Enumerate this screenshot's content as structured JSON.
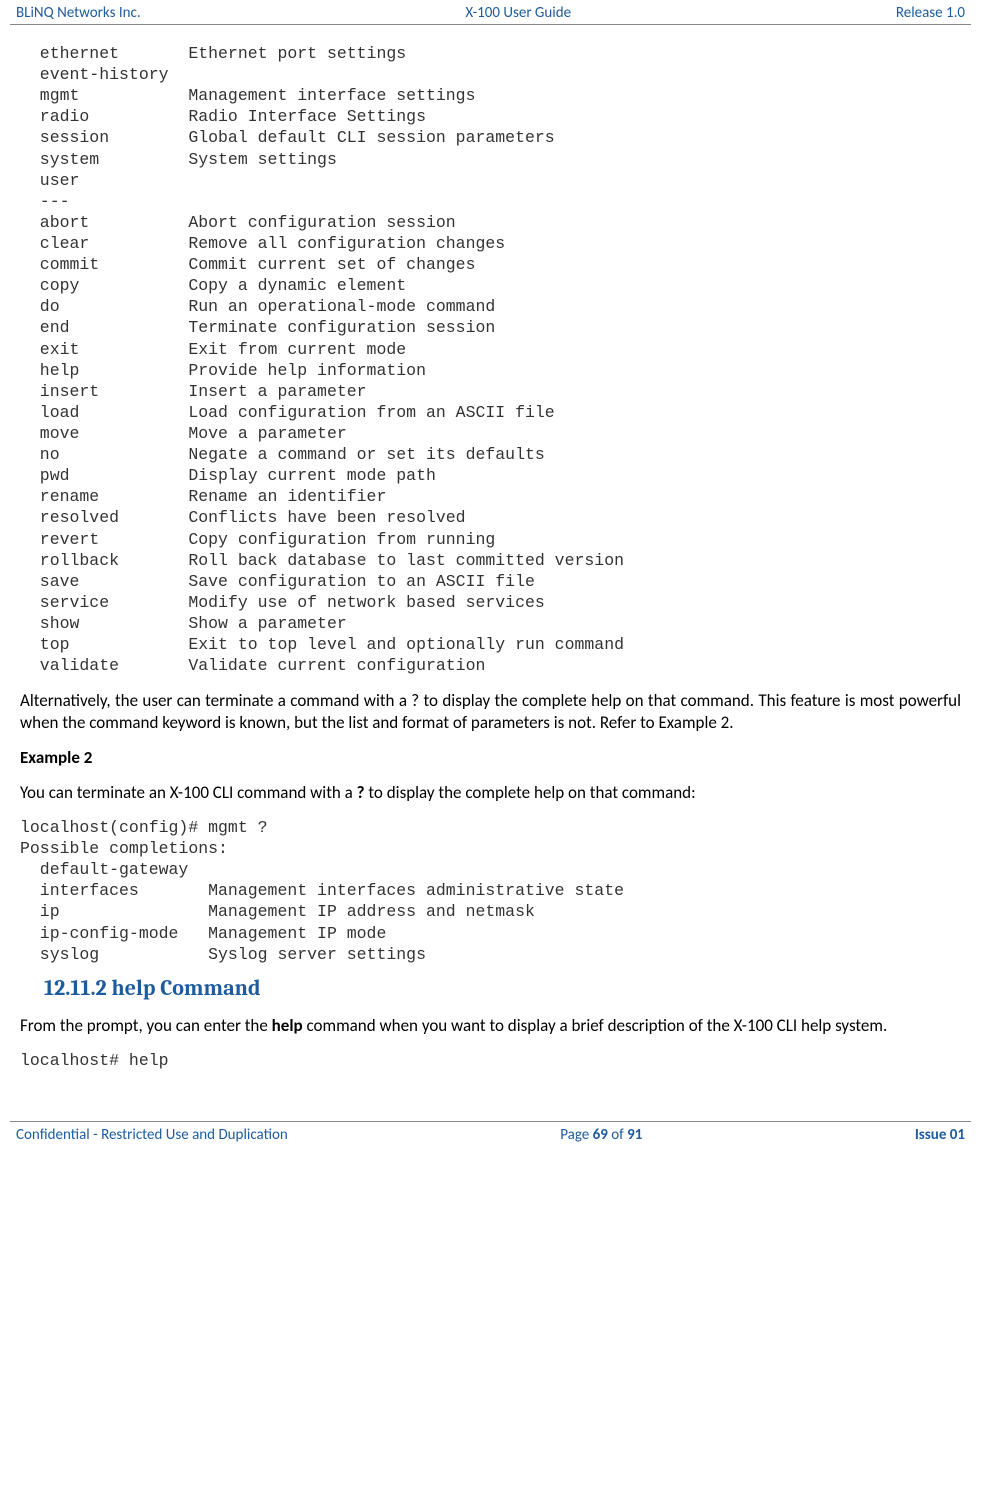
{
  "header": {
    "left": "BLiNQ Networks Inc.",
    "center": "X-100 User Guide",
    "right": "Release 1.0"
  },
  "block1": "  ethernet       Ethernet port settings\n  event-history\n  mgmt           Management interface settings\n  radio          Radio Interface Settings\n  session        Global default CLI session parameters\n  system         System settings\n  user\n  ---\n  abort          Abort configuration session\n  clear          Remove all configuration changes\n  commit         Commit current set of changes\n  copy           Copy a dynamic element\n  do             Run an operational-mode command\n  end            Terminate configuration session\n  exit           Exit from current mode\n  help           Provide help information\n  insert         Insert a parameter\n  load           Load configuration from an ASCII file\n  move           Move a parameter\n  no             Negate a command or set its defaults\n  pwd            Display current mode path\n  rename         Rename an identifier\n  resolved       Conflicts have been resolved\n  revert         Copy configuration from running\n  rollback       Roll back database to last committed version\n  save           Save configuration to an ASCII file\n  service        Modify use of network based services\n  show           Show a parameter\n  top            Exit to top level and optionally run command\n  validate       Validate current configuration",
  "para1_a": "Alternatively, the user can terminate a command with a ? to display the complete help on that command.  This feature is most powerful when the command keyword is known, but the list and format of parameters is not. Refer to Example 2.",
  "ex2_heading": "Example 2",
  "para2_a": "You can terminate an X-100 CLI command with a ",
  "para2_b": "?",
  "para2_c": " to display the complete help on that command:",
  "block2": "localhost(config)# mgmt ?\nPossible completions:\n  default-gateway\n  interfaces       Management interfaces administrative state\n  ip               Management IP address and netmask\n  ip-config-mode   Management IP mode\n  syslog           Syslog server settings",
  "h3": "12.11.2 help Command",
  "para3_a": "From the prompt, you can enter the ",
  "para3_b": "help",
  "para3_c": " command when you want to display a brief description of the X-100 CLI help system.",
  "block3": "localhost# help",
  "footer": {
    "left": "Confidential - Restricted Use and Duplication",
    "center_a": "Page ",
    "center_b": "69",
    "center_c": " of ",
    "center_d": "91",
    "right": "Issue 01"
  }
}
